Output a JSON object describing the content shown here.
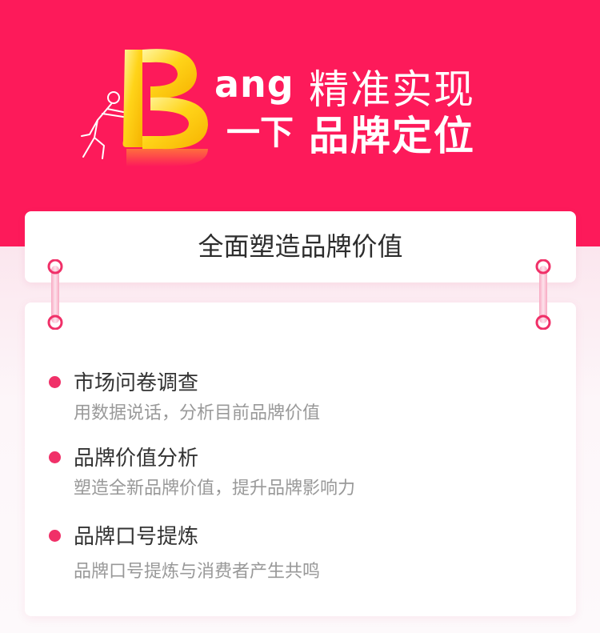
{
  "hero": {
    "brand_latin": "ang",
    "brand_cn": "一下",
    "slogan_line1": "精准实现",
    "slogan_line2": "品牌定位"
  },
  "title_card": {
    "title": "全面塑造品牌价值"
  },
  "items": [
    {
      "title": "市场问卷调查",
      "desc": "用数据说话，分析目前品牌价值"
    },
    {
      "title": "品牌价值分析",
      "desc": "塑造全新品牌价值，提升品牌影响力"
    },
    {
      "title": "品牌口号提炼",
      "desc": "品牌口号提炼与消费者产生共鸣"
    }
  ],
  "colors": {
    "banner": "#fd1a5a",
    "accent": "#f03068",
    "logo_gold": "#ffd21c"
  },
  "icons": [
    "letter-b-logo-icon",
    "pushing-man-icon",
    "binder-ring-icon"
  ]
}
